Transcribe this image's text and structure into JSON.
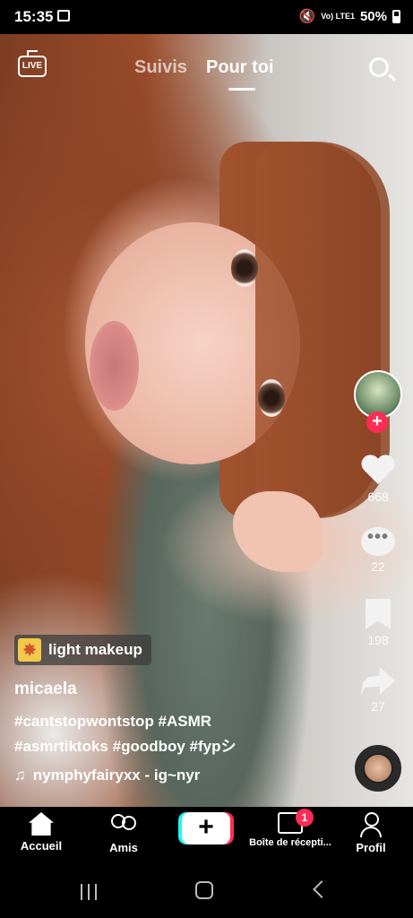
{
  "status_bar": {
    "time": "15:35",
    "network": "Vo) LTE1",
    "battery": "50%"
  },
  "top_nav": {
    "live_label": "LIVE",
    "tabs": [
      {
        "label": "Suivis",
        "active": false
      },
      {
        "label": "Pour toi",
        "active": true
      }
    ]
  },
  "actions": {
    "likes": "668",
    "comments": "22",
    "comments_glyph": "•••",
    "saves": "198",
    "shares": "27",
    "follow_glyph": "+"
  },
  "video_info": {
    "effect_label": "light makeup",
    "username": "micaela",
    "caption_line1": "#cantstopwontstop #ASMR",
    "caption_line2": "#asmrtiktoks #goodboy #fypシ",
    "music_glyph": "♫",
    "sound": "nymphyfairyxx - ig~nyr"
  },
  "bottom_nav": {
    "home": "Accueil",
    "friends": "Amis",
    "create_glyph": "+",
    "inbox": "Boîte de récepti...",
    "inbox_badge": "1",
    "profile": "Profil"
  },
  "colors": {
    "accent": "#fe2c55",
    "cyan": "#25f4ee"
  }
}
